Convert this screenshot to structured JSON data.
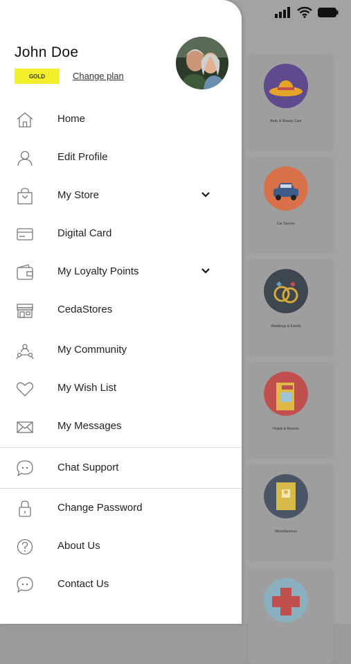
{
  "user": {
    "name": "John Doe",
    "plan_badge": "GOLD",
    "change_plan_label": "Change plan"
  },
  "menu": [
    {
      "label": "Home",
      "icon": "home-icon"
    },
    {
      "label": "Edit Profile",
      "icon": "user-icon"
    },
    {
      "label": "My Store",
      "icon": "store-bag-icon",
      "expandable": true
    },
    {
      "label": "Digital Card",
      "icon": "card-icon"
    },
    {
      "label": "My Loyalty Points",
      "icon": "wallet-icon",
      "expandable": true
    },
    {
      "label": "CedaStores",
      "icon": "storefront-icon"
    },
    {
      "label": "My Community",
      "icon": "community-icon"
    },
    {
      "label": "My Wish List",
      "icon": "heart-icon"
    },
    {
      "label": "My Messages",
      "icon": "envelope-icon"
    },
    {
      "label": "Chat Support",
      "icon": "chat-icon"
    },
    {
      "label": "Change Password",
      "icon": "lock-icon"
    },
    {
      "label": "About Us",
      "icon": "question-icon"
    },
    {
      "label": "Contact Us",
      "icon": "chat-icon"
    }
  ],
  "background": {
    "categories": [
      {
        "label": "Body & Beauty Care"
      },
      {
        "label": "Car Service"
      },
      {
        "label": "Weddings & Events"
      },
      {
        "label": "Hotels & Resorts"
      },
      {
        "label": "Miscellaneous"
      }
    ]
  },
  "colors": {
    "badge": "#f2ef2a",
    "drawer_bg": "#ffffff",
    "overlay": "#a3a3a3"
  }
}
